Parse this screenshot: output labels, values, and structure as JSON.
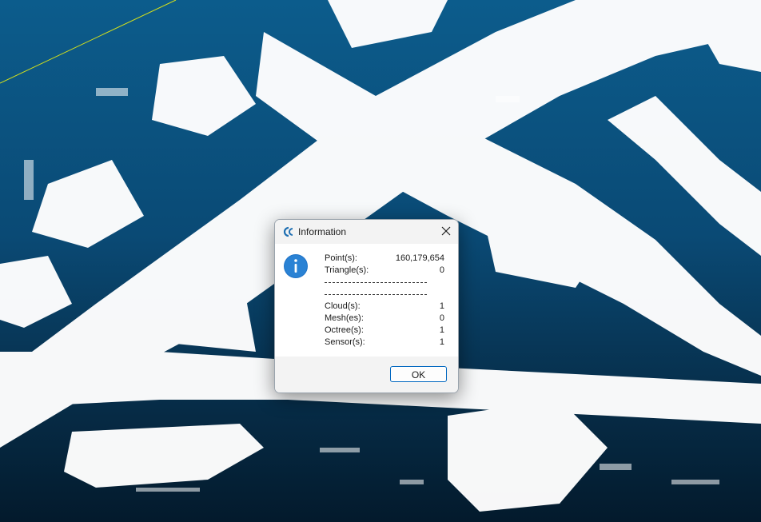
{
  "viewport": {
    "name": "point-cloud-3d-view"
  },
  "dialog": {
    "title": "Information",
    "app_icon": "cloudcompare-icon",
    "close_icon": "close-icon",
    "info_icon": "info-icon",
    "rows": [
      {
        "label": "Point(s):",
        "value": "160,179,654"
      },
      {
        "label": "Triangle(s):",
        "value": "0"
      }
    ],
    "rows2": [
      {
        "label": "Cloud(s):",
        "value": "1"
      },
      {
        "label": "Mesh(es):",
        "value": "0"
      },
      {
        "label": "Octree(s):",
        "value": "1"
      },
      {
        "label": "Sensor(s):",
        "value": "1"
      }
    ],
    "ok_label": "OK",
    "accent": "#0067c0"
  }
}
